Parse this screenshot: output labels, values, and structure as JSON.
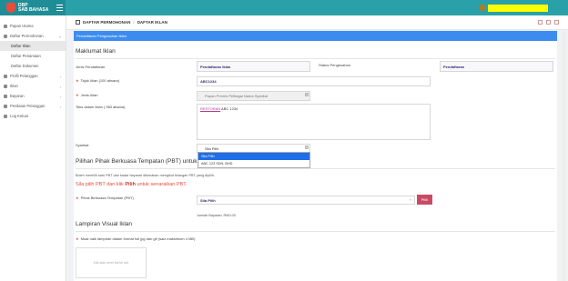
{
  "app": {
    "logo_line1": "DBP",
    "logo_line2": "SAB BAHASA"
  },
  "sidebar": {
    "items": [
      {
        "label": "Papan Utama"
      },
      {
        "label": "Daftar Permohonan",
        "arrow": "˅"
      },
      {
        "label": "Profil Pelanggan",
        "arrow": "›"
      },
      {
        "label": "Iklan",
        "arrow": "›"
      },
      {
        "label": "Bayaran",
        "arrow": "›"
      },
      {
        "label": "Penilaian Pelanggan",
        "arrow": "›"
      },
      {
        "label": "Log Keluar"
      }
    ],
    "subitems": [
      {
        "label": "Daftar Iklan"
      },
      {
        "label": "Daftar Penamaan"
      },
      {
        "label": "Daftar Dokumen"
      }
    ]
  },
  "breadcrumb": {
    "item1": "DAFTAR PERMOHONAN",
    "sep": "/",
    "item2": "DAFTAR IKLAN"
  },
  "form": {
    "banner": "Pendaftaran Pengesahan Iklan",
    "section1_title": "Maklumat Iklan",
    "jenis_pendaftaran_label": "Jenis Pendaftaran",
    "jenis_pendaftaran_value": "Pendaftaran Iklan",
    "status_label": "Status Pengesahan",
    "status_value": "Pendaftaran",
    "tajuk_label": "Tajuk Iklan (100 aksara)",
    "tajuk_value": "ABC1234",
    "jenis_label": "Jenis Iklan",
    "jenis_value": "Papan Premis Pelbagai Nama Syarikat",
    "teks_label": "Teks dalam Iklan ( 983 aksara)",
    "teks_hl": "RESTORAN",
    "teks_rest": " ABC 1234",
    "syarikat_label": "Syarikat",
    "syarikat_value": "Sila Pilih",
    "syarikat_options": [
      "Sila Pilih",
      "ABC 123 SDN. BHD"
    ],
    "section2_title": "Pilihan Pihak Berkuasa Tempatan (PBT) untuk L",
    "info_text": "Boleh memilih satu PBT dan kadar bayaran dikenakan mengikut bilangan PBT yang dipilih.",
    "red_note_pre": "Sila pilih PBT dan klik ",
    "red_note_bold": "Pilih",
    "red_note_post": " untuk senaraikan PBT.",
    "pbt_label": "Pihak Berkuasa Tempatan (PBT)",
    "pbt_value": "Sila Pilih",
    "pilih_button": "Pilih",
    "jumlah_text": "Jumlah Bayaran: RM0.00",
    "section3_title": "Lampiran Visual Iklan",
    "lampiran_label": "Muat naik lampiran dalam format foil jpg dan gif (saiz maksimum 4 MB)",
    "upload_placeholder": "Klik atau seret fail ke sini"
  }
}
